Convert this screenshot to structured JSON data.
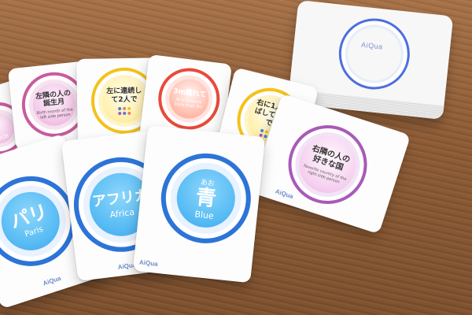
{
  "scene": {
    "brand": "AiQua"
  },
  "cards": {
    "deck": {
      "brand": "AiQua"
    },
    "partial_left": {
      "jp": "",
      "en": "face"
    },
    "left_birth_month": {
      "jp": "左隣の人の誕生月",
      "en": "Birth month of the left side person"
    },
    "continuous_two": {
      "jp": "左に連続して2人で",
      "en": ""
    },
    "distance": {
      "jp": "3m離れて",
      "en": "At a distance more than 3m"
    },
    "separated_two": {
      "jp": "右に1人飛ばして2人で",
      "en": ""
    },
    "favorite_country": {
      "jp": "右隣の人の好きな国",
      "en": "Favorite country of the right side person"
    },
    "paris": {
      "jp": "パリ",
      "en": "Paris"
    },
    "africa": {
      "jp": "アフリカ",
      "en": "Africa"
    },
    "blue": {
      "ruby": "あお",
      "jp": "青",
      "en": "Blue"
    }
  },
  "colors": {
    "wood": "#8a5a35",
    "card": "#fdfdfd",
    "blue_ring": "#2d74d8",
    "pink_ring": "#c95b9e",
    "yellow_ring": "#f3c21a",
    "orange_ring": "#e74b3b",
    "purple_ring": "#a85ab8",
    "deck_ring": "#4c6ee0"
  }
}
